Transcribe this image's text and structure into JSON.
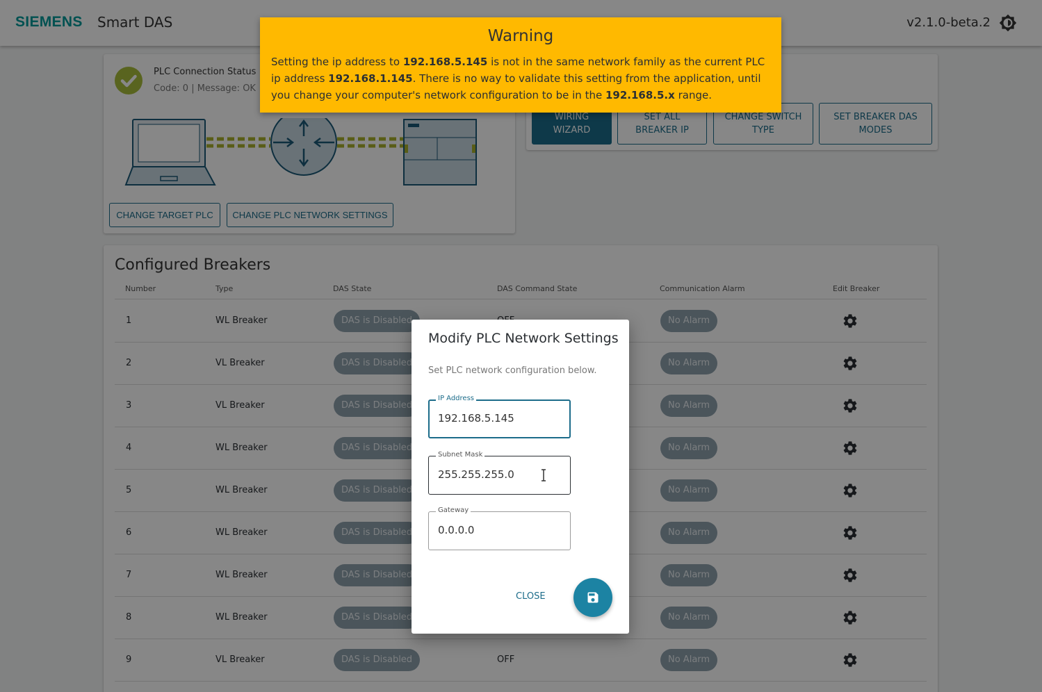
{
  "header": {
    "brand": "SIEMENS",
    "app_name": "Smart DAS",
    "version": "v2.1.0-beta.2",
    "theme_icon": "brightness-icon"
  },
  "status": {
    "title": "PLC Connection Status",
    "message": "Code: 0 | Message: OK",
    "change_target_label": "CHANGE TARGET PLC",
    "change_network_label": "CHANGE PLC NETWORK SETTINGS"
  },
  "actions": {
    "wizard_line1": "WIRING",
    "wizard_line2": "WIZARD",
    "ip_line1": "SET ALL",
    "ip_line2": "BREAKER IP",
    "switch_line1": "CHANGE SWITCH",
    "switch_line2": "TYPE",
    "modes_line1": "SET BREAKER DAS",
    "modes_line2": "MODES"
  },
  "breakers": {
    "title": "Configured Breakers",
    "columns": [
      "Number",
      "Type",
      "DAS State",
      "DAS Command State",
      "Communication Alarm",
      "Edit Breaker"
    ],
    "rows": [
      {
        "number": "1",
        "type": "WL Breaker",
        "das_state": "DAS is Disabled",
        "command_state": "OFF",
        "alarm": "No Alarm"
      },
      {
        "number": "2",
        "type": "VL Breaker",
        "das_state": "DAS is Disabled",
        "command_state": "",
        "alarm": "No Alarm"
      },
      {
        "number": "3",
        "type": "VL Breaker",
        "das_state": "DAS is Disabled",
        "command_state": "",
        "alarm": "No Alarm"
      },
      {
        "number": "4",
        "type": "WL Breaker",
        "das_state": "DAS is Disabled",
        "command_state": "",
        "alarm": "No Alarm"
      },
      {
        "number": "5",
        "type": "WL Breaker",
        "das_state": "DAS is Disabled",
        "command_state": "",
        "alarm": "No Alarm"
      },
      {
        "number": "6",
        "type": "WL Breaker",
        "das_state": "DAS is Disabled",
        "command_state": "",
        "alarm": "No Alarm"
      },
      {
        "number": "7",
        "type": "WL Breaker",
        "das_state": "DAS is Disabled",
        "command_state": "",
        "alarm": "No Alarm"
      },
      {
        "number": "8",
        "type": "WL Breaker",
        "das_state": "DAS is Disabled",
        "command_state": "",
        "alarm": "No Alarm"
      },
      {
        "number": "9",
        "type": "VL Breaker",
        "das_state": "DAS is Disabled",
        "command_state": "OFF",
        "alarm": "No Alarm"
      }
    ]
  },
  "dialog": {
    "title": "Modify PLC Network Settings",
    "description": "Set PLC network configuration below.",
    "ip_label": "IP Address",
    "ip_value": "192.168.5.145",
    "subnet_label": "Subnet Mask",
    "subnet_value": "255.255.255.0",
    "gateway_label": "Gateway",
    "gateway_value": "0.0.0.0",
    "close_label": "CLOSE",
    "save_icon": "save-icon"
  },
  "warning": {
    "title": "Warning",
    "t1": "Setting the ip address to ",
    "b1": "192.168.5.145",
    "t2": " is not in the same network family as the current PLC ip address ",
    "b2": "192.168.1.145",
    "t3": ". There is no way to validate this setting from the application, until you change your computer's network configuration to be in the ",
    "b3": "192.168.5.x",
    "t4": " range."
  },
  "colors": {
    "brand": "#009999",
    "primary": "#1c6c8a",
    "warning": "#ffb900",
    "chip": "#8fa1ad",
    "status_ok": "#a8bd3c"
  }
}
